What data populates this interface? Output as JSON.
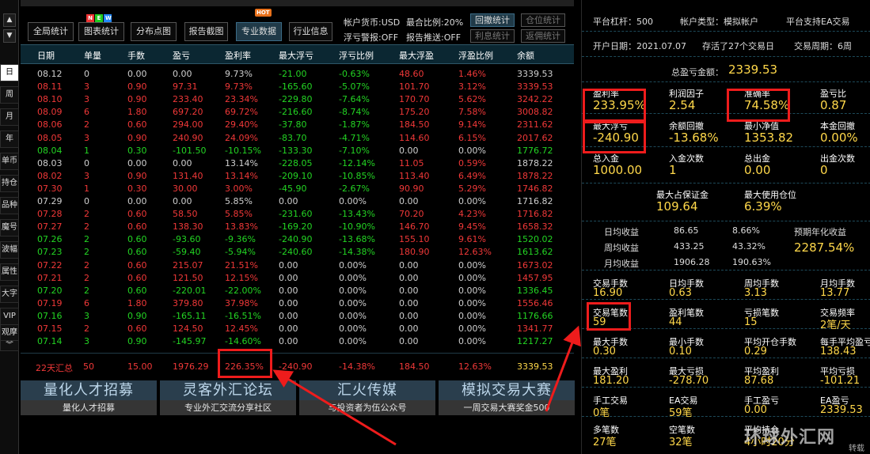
{
  "sidebar": {
    "up_arrow": "▲",
    "down_arrow": "▼",
    "tabs": [
      "日",
      "周",
      "月",
      "年",
      "单币",
      "持仓",
      "品种",
      "魔号",
      "波幅",
      "属性",
      "大字",
      "VIP",
      "观摩",
      "︾"
    ],
    "active_tab": "日",
    "side_arrow": "〈"
  },
  "toolbar": {
    "buttons": [
      "全局统计",
      "图表统计",
      "分布点图",
      "报告截图",
      "专业数据",
      "行业信息"
    ],
    "selected": "专业数据",
    "new_badge": [
      "N",
      "E",
      "W"
    ],
    "hot_badge": "HOT",
    "info": {
      "currency": "帐户货币:USD",
      "max_ratio": "最合比例:20%",
      "float_alert": "浮亏警报:OFF",
      "report_push": "报告推送:OFF"
    },
    "small_buttons": [
      "回撤统计",
      "仓位统计",
      "利息统计",
      "返佣统计"
    ]
  },
  "table": {
    "headers": [
      "日期",
      "单量",
      "手数",
      "盈亏",
      "盈利率",
      "最大浮亏",
      "浮亏比例",
      "最大浮盈",
      "浮盈比例",
      "余额"
    ],
    "rows": [
      [
        "08.12",
        "0",
        "0.00",
        "0.00",
        "9.73%",
        "-21.00",
        "-0.63%",
        "48.60",
        "1.46%",
        "3339.53"
      ],
      [
        "08.11",
        "3",
        "0.90",
        "97.31",
        "9.73%",
        "-165.60",
        "-5.07%",
        "101.70",
        "3.12%",
        "3339.53"
      ],
      [
        "08.10",
        "3",
        "0.90",
        "233.40",
        "23.34%",
        "-229.80",
        "-7.64%",
        "170.70",
        "5.62%",
        "3242.22"
      ],
      [
        "08.09",
        "6",
        "1.80",
        "697.20",
        "69.72%",
        "-216.60",
        "-8.74%",
        "175.20",
        "7.58%",
        "3008.82"
      ],
      [
        "08.06",
        "2",
        "0.60",
        "294.00",
        "29.40%",
        "-37.80",
        "-1.87%",
        "184.50",
        "9.14%",
        "2311.62"
      ],
      [
        "08.05",
        "3",
        "0.90",
        "240.90",
        "24.09%",
        "-83.70",
        "-4.71%",
        "114.60",
        "6.15%",
        "2017.62"
      ],
      [
        "08.04",
        "1",
        "0.30",
        "-101.50",
        "-10.15%",
        "-133.30",
        "-7.10%",
        "0.00",
        "0.00%",
        "1776.72"
      ],
      [
        "08.03",
        "0",
        "0.00",
        "0.00",
        "13.14%",
        "-228.05",
        "-12.14%",
        "11.05",
        "0.59%",
        "1878.22"
      ],
      [
        "08.02",
        "3",
        "0.90",
        "131.40",
        "13.14%",
        "-209.10",
        "-10.85%",
        "113.40",
        "6.49%",
        "1878.22"
      ],
      [
        "07.30",
        "1",
        "0.30",
        "30.00",
        "3.00%",
        "-45.90",
        "-2.67%",
        "90.90",
        "5.29%",
        "1746.82"
      ],
      [
        "07.29",
        "0",
        "0.00",
        "0.00",
        "5.85%",
        "0.00",
        "0.00%",
        "0.00",
        "0.00%",
        "1716.82"
      ],
      [
        "07.28",
        "2",
        "0.60",
        "58.50",
        "5.85%",
        "-231.60",
        "-13.43%",
        "70.20",
        "4.23%",
        "1716.82"
      ],
      [
        "07.27",
        "2",
        "0.60",
        "138.30",
        "13.83%",
        "-169.20",
        "-10.90%",
        "146.70",
        "9.45%",
        "1658.32"
      ],
      [
        "07.26",
        "2",
        "0.60",
        "-93.60",
        "-9.36%",
        "-240.90",
        "-13.68%",
        "155.10",
        "9.61%",
        "1520.02"
      ],
      [
        "07.23",
        "2",
        "0.60",
        "-59.40",
        "-5.94%",
        "-240.60",
        "-14.38%",
        "180.90",
        "12.63%",
        "1613.62"
      ],
      [
        "07.22",
        "2",
        "0.60",
        "215.07",
        "21.51%",
        "0.00",
        "0.00%",
        "0.00",
        "0.00%",
        "1673.02"
      ],
      [
        "07.21",
        "2",
        "0.60",
        "121.50",
        "12.15%",
        "0.00",
        "0.00%",
        "0.00",
        "0.00%",
        "1457.95"
      ],
      [
        "07.20",
        "2",
        "0.60",
        "-220.01",
        "-22.00%",
        "0.00",
        "0.00%",
        "0.00",
        "0.00%",
        "1336.45"
      ],
      [
        "07.19",
        "6",
        "1.80",
        "379.80",
        "37.98%",
        "0.00",
        "0.00%",
        "0.00",
        "0.00%",
        "1556.46"
      ],
      [
        "07.16",
        "3",
        "0.90",
        "-165.11",
        "-16.51%",
        "0.00",
        "0.00%",
        "0.00",
        "0.00%",
        "1176.66"
      ],
      [
        "07.15",
        "2",
        "0.60",
        "124.50",
        "12.45%",
        "0.00",
        "0.00%",
        "0.00",
        "0.00%",
        "1341.77"
      ],
      [
        "07.14",
        "3",
        "0.90",
        "-145.97",
        "-14.60%",
        "0.00",
        "0.00%",
        "0.00",
        "0.00%",
        "1217.27"
      ]
    ],
    "row_colors": [
      "wht",
      "red",
      "red",
      "red",
      "red",
      "red",
      "grn",
      "wht",
      "red",
      "red",
      "wht",
      "red",
      "red",
      "grn",
      "grn",
      "red",
      "red",
      "grn",
      "red",
      "grn",
      "red",
      "grn"
    ],
    "summary": [
      "22天汇总",
      "50",
      "15.00",
      "1976.29",
      "226.35%",
      "-240.90",
      "-14.38%",
      "184.50",
      "12.63%",
      "3339.53"
    ]
  },
  "banners": [
    {
      "title": "量化人才招募",
      "sub": "量化人才招募"
    },
    {
      "title": "灵客外汇论坛",
      "sub": "专业外汇交流分享社区"
    },
    {
      "title": "汇火传媒",
      "sub": "与投资者为伍公众号"
    },
    {
      "title": "模拟交易大赛",
      "sub": "一周交易大赛奖金500"
    }
  ],
  "panel": {
    "r1": [
      "平台杠杆：500",
      "帐户类型：模拟帐户",
      "平台支持EA交易"
    ],
    "r2": [
      "开户日期：2021.07.07",
      "存活了27个交易日",
      "交易周期：6周"
    ],
    "total_label": "总盈亏金额：",
    "total_value": "2339.53",
    "m1": [
      [
        "盈利率",
        "233.95%"
      ],
      [
        "利润因子",
        "2.54"
      ],
      [
        "准确率",
        "74.58%"
      ],
      [
        "盈亏比",
        "0.87"
      ]
    ],
    "m2": [
      [
        "最大浮亏",
        "-240.90"
      ],
      [
        "余额回撤",
        "-13.68%"
      ],
      [
        "最小净值",
        "1353.82"
      ],
      [
        "本金回撤",
        "0.00%"
      ]
    ],
    "m3": [
      [
        "总入金",
        "1000.00"
      ],
      [
        "入金次数",
        "1"
      ],
      [
        "总出金",
        "0.00"
      ],
      [
        "出金次数",
        "0"
      ]
    ],
    "m4": [
      [
        "最大占保证金",
        "109.64"
      ],
      [
        "最大使用仓位",
        "6.39%"
      ]
    ],
    "avg": [
      [
        "日均收益",
        "86.65",
        "8.66%"
      ],
      [
        "周均收益",
        "433.25",
        "43.32%"
      ],
      [
        "月均收益",
        "1906.28",
        "190.63%"
      ]
    ],
    "annual_label": "预期年化收益",
    "annual_value": "2287.54%",
    "g1": [
      [
        "交易手数",
        "16.90"
      ],
      [
        "日均手数",
        "0.63"
      ],
      [
        "周均手数",
        "3.13"
      ],
      [
        "月均手数",
        "13.77"
      ]
    ],
    "g2": [
      [
        "交易笔数",
        "59"
      ],
      [
        "盈利笔数",
        "44"
      ],
      [
        "亏损笔数",
        "15"
      ],
      [
        "交易频率",
        "2笔/天"
      ]
    ],
    "g3": [
      [
        "最大手数",
        "0.30"
      ],
      [
        "最小手数",
        "0.10"
      ],
      [
        "平均开仓手数",
        "0.29"
      ],
      [
        "每手平均盈亏",
        "138.43"
      ]
    ],
    "g4": [
      [
        "最大盈利",
        "181.20"
      ],
      [
        "最大亏损",
        "-278.70"
      ],
      [
        "平均盈利",
        "87.68"
      ],
      [
        "平均亏损",
        "-101.21"
      ]
    ],
    "g5": [
      [
        "手工交易",
        "0笔"
      ],
      [
        "EA交易",
        "59笔"
      ],
      [
        "手工盈亏",
        "0.00"
      ],
      [
        "EA盈亏",
        "2339.53"
      ]
    ],
    "g6": [
      [
        "多笔数",
        "27笔"
      ],
      [
        "空笔数",
        "32笔"
      ],
      [
        "平均持仓",
        "4小时20分"
      ]
    ]
  },
  "watermark": "环球外汇网",
  "watermark_sub": "转载",
  "colors": {
    "accent_red": "#ee1c1c",
    "value_yellow": "#ffd84a",
    "profit_red": "#f03838",
    "loss_green": "#23d423",
    "header_bg": "#0b2732"
  }
}
